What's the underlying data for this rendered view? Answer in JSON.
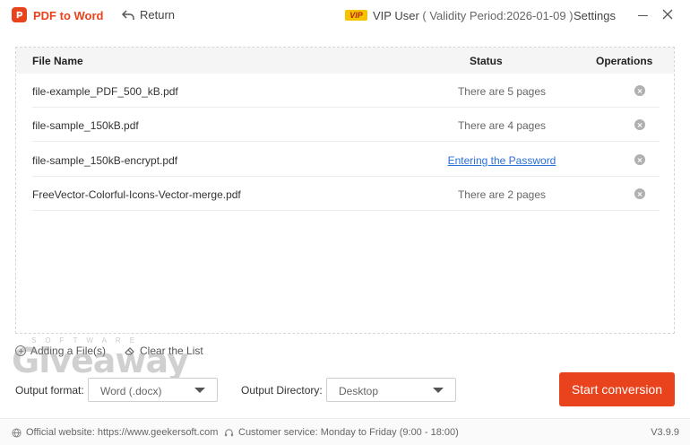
{
  "app": {
    "title": "PDF to Word",
    "return_label": "Return",
    "vip_badge": "VIP",
    "vip_user": "VIP User",
    "vip_validity": "( Validity Period:2026-01-09 )",
    "settings_label": "Settings"
  },
  "list": {
    "headers": {
      "name": "File Name",
      "status": "Status",
      "operations": "Operations"
    },
    "rows": [
      {
        "name": "file-example_PDF_500_kB.pdf",
        "status": "There are 5 pages"
      },
      {
        "name": "file-sample_150kB.pdf",
        "status": "There are 4 pages"
      },
      {
        "name": "file-sample_150kB-encrypt.pdf",
        "status": "Entering the Password"
      },
      {
        "name": "FreeVector-Colorful-Icons-Vector-merge.pdf",
        "status": "There are 2 pages"
      }
    ]
  },
  "actions": {
    "add_file": "Adding a File(s)",
    "clear_list": "Clear the List"
  },
  "watermark": {
    "main": "Giveaway",
    "sub": "SOFTWARE"
  },
  "output": {
    "format_label": "Output format:",
    "format_value": "Word (.docx)",
    "directory_label": "Output Directory:",
    "directory_value": "Desktop",
    "start_label": "Start conversion"
  },
  "footer": {
    "website": "Official website: https://www.geekersoft.com",
    "service": "Customer service: Monday to Friday (9:00 - 18:00)",
    "version": "V3.9.9"
  },
  "colors": {
    "accent": "#e8431c",
    "link": "#2a6fd6",
    "vip": "#f7c300"
  }
}
